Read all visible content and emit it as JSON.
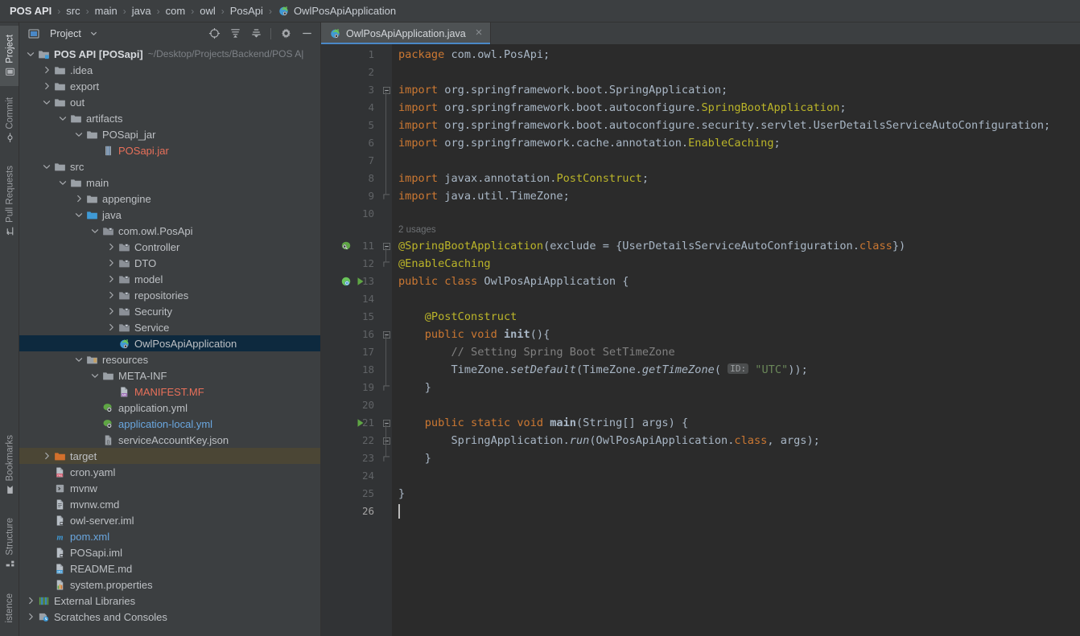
{
  "breadcrumb": {
    "items": [
      {
        "label": "POS API",
        "bold": true,
        "icon": null
      },
      {
        "label": "src",
        "bold": false,
        "icon": null
      },
      {
        "label": "main",
        "bold": false,
        "icon": null
      },
      {
        "label": "java",
        "bold": false,
        "icon": null
      },
      {
        "label": "com",
        "bold": false,
        "icon": null
      },
      {
        "label": "owl",
        "bold": false,
        "icon": null
      },
      {
        "label": "PosApi",
        "bold": false,
        "icon": null
      },
      {
        "label": "OwlPosApiApplication",
        "bold": false,
        "icon": "spring-boot-class-icon"
      }
    ],
    "separator": "›"
  },
  "tool_strip": {
    "top_items": [
      {
        "label": "Project",
        "icon": "project-icon",
        "active": true
      },
      {
        "label": "Commit",
        "icon": "commit-icon",
        "active": false
      },
      {
        "label": "Pull Requests",
        "icon": "pull-requests-icon",
        "active": false
      }
    ],
    "bottom_items": [
      {
        "label": "Bookmarks",
        "icon": "bookmarks-icon",
        "active": false
      },
      {
        "label": "Structure",
        "icon": "structure-icon",
        "active": false
      },
      {
        "label": "istence",
        "icon": null,
        "active": false
      }
    ]
  },
  "project_panel": {
    "title": "Project",
    "dropdown_icon": "chevron-down-icon",
    "tools": [
      {
        "name": "select-opened-file-icon",
        "title": "locate"
      },
      {
        "name": "expand-all-icon",
        "title": "expand all"
      },
      {
        "name": "collapse-all-icon",
        "title": "collapse all"
      },
      {
        "name": "settings-gear-icon",
        "title": "settings"
      },
      {
        "name": "minimize-icon",
        "title": "hide"
      }
    ],
    "tree": [
      {
        "label": "POS API [POSapi]",
        "suffix": "~/Desktop/Projects/Backend/POS A|",
        "depth": 0,
        "icon": "project-root-icon",
        "arrow": "down",
        "style": "bold",
        "state": "normal"
      },
      {
        "label": ".idea",
        "depth": 1,
        "icon": "folder-icon",
        "arrow": "right",
        "style": "normal",
        "state": "normal"
      },
      {
        "label": "export",
        "depth": 1,
        "icon": "folder-icon",
        "arrow": "right",
        "style": "normal",
        "state": "normal"
      },
      {
        "label": "out",
        "depth": 1,
        "icon": "folder-icon",
        "arrow": "down",
        "style": "normal",
        "state": "normal"
      },
      {
        "label": "artifacts",
        "depth": 2,
        "icon": "folder-icon",
        "arrow": "down",
        "style": "normal",
        "state": "normal"
      },
      {
        "label": "POSapi_jar",
        "depth": 3,
        "icon": "folder-icon",
        "arrow": "down",
        "style": "normal",
        "state": "normal"
      },
      {
        "label": "POSapi.jar",
        "depth": 4,
        "icon": "jar-icon",
        "arrow": "none",
        "style": "red",
        "state": "normal"
      },
      {
        "label": "src",
        "depth": 1,
        "icon": "folder-icon",
        "arrow": "down",
        "style": "normal",
        "state": "normal"
      },
      {
        "label": "main",
        "depth": 2,
        "icon": "folder-icon",
        "arrow": "down",
        "style": "normal",
        "state": "normal"
      },
      {
        "label": "appengine",
        "depth": 3,
        "icon": "folder-icon",
        "arrow": "right",
        "style": "normal",
        "state": "normal"
      },
      {
        "label": "java",
        "depth": 3,
        "icon": "source-folder-icon",
        "arrow": "down",
        "style": "normal",
        "state": "normal"
      },
      {
        "label": "com.owl.PosApi",
        "depth": 4,
        "icon": "package-icon",
        "arrow": "down",
        "style": "normal",
        "state": "normal"
      },
      {
        "label": "Controller",
        "depth": 5,
        "icon": "package-icon",
        "arrow": "right",
        "style": "normal",
        "state": "normal"
      },
      {
        "label": "DTO",
        "depth": 5,
        "icon": "package-icon",
        "arrow": "right",
        "style": "normal",
        "state": "normal"
      },
      {
        "label": "model",
        "depth": 5,
        "icon": "package-icon",
        "arrow": "right",
        "style": "normal",
        "state": "normal"
      },
      {
        "label": "repositories",
        "depth": 5,
        "icon": "package-icon",
        "arrow": "right",
        "style": "normal",
        "state": "normal"
      },
      {
        "label": "Security",
        "depth": 5,
        "icon": "package-icon",
        "arrow": "right",
        "style": "normal",
        "state": "normal"
      },
      {
        "label": "Service",
        "depth": 5,
        "icon": "package-icon",
        "arrow": "right",
        "style": "normal",
        "state": "normal"
      },
      {
        "label": "OwlPosApiApplication",
        "depth": 5,
        "icon": "spring-boot-class-icon",
        "arrow": "none",
        "style": "normal",
        "state": "selected"
      },
      {
        "label": "resources",
        "depth": 3,
        "icon": "resource-folder-icon",
        "arrow": "down",
        "style": "normal",
        "state": "normal"
      },
      {
        "label": "META-INF",
        "depth": 4,
        "icon": "folder-icon",
        "arrow": "down",
        "style": "normal",
        "state": "normal"
      },
      {
        "label": "MANIFEST.MF",
        "depth": 5,
        "icon": "manifest-file-icon",
        "arrow": "none",
        "style": "red",
        "state": "normal"
      },
      {
        "label": "application.yml",
        "depth": 4,
        "icon": "spring-yaml-icon",
        "arrow": "none",
        "style": "normal",
        "state": "normal"
      },
      {
        "label": "application-local.yml",
        "depth": 4,
        "icon": "spring-yaml-icon",
        "arrow": "none",
        "style": "blue",
        "state": "normal"
      },
      {
        "label": "serviceAccountKey.json",
        "depth": 4,
        "icon": "json-file-icon",
        "arrow": "none",
        "style": "normal",
        "state": "normal"
      },
      {
        "label": "target",
        "depth": 1,
        "icon": "excluded-folder-icon",
        "arrow": "right",
        "style": "normal",
        "state": "hovered"
      },
      {
        "label": "cron.yaml",
        "depth": 1,
        "icon": "yaml-file-icon",
        "arrow": "none",
        "style": "normal",
        "state": "normal"
      },
      {
        "label": "mvnw",
        "depth": 1,
        "icon": "script-file-icon",
        "arrow": "none",
        "style": "normal",
        "state": "normal"
      },
      {
        "label": "mvnw.cmd",
        "depth": 1,
        "icon": "text-file-icon",
        "arrow": "none",
        "style": "normal",
        "state": "normal"
      },
      {
        "label": "owl-server.iml",
        "depth": 1,
        "icon": "iml-file-icon",
        "arrow": "none",
        "style": "normal",
        "state": "normal"
      },
      {
        "label": "pom.xml",
        "depth": 1,
        "icon": "maven-icon",
        "arrow": "none",
        "style": "blue",
        "state": "normal"
      },
      {
        "label": "POSapi.iml",
        "depth": 1,
        "icon": "iml-file-icon",
        "arrow": "none",
        "style": "normal",
        "state": "normal"
      },
      {
        "label": "README.md",
        "depth": 1,
        "icon": "markdown-file-icon",
        "arrow": "none",
        "style": "normal",
        "state": "normal"
      },
      {
        "label": "system.properties",
        "depth": 1,
        "icon": "properties-file-icon",
        "arrow": "none",
        "style": "normal",
        "state": "normal"
      },
      {
        "label": "External Libraries",
        "depth": 0,
        "icon": "libraries-icon",
        "arrow": "right",
        "style": "normal",
        "state": "normal"
      },
      {
        "label": "Scratches and Consoles",
        "depth": 0,
        "icon": "scratches-icon",
        "arrow": "right",
        "style": "normal",
        "state": "normal"
      }
    ]
  },
  "editor": {
    "tabs": [
      {
        "label": "OwlPosApiApplication.java",
        "icon": "spring-boot-class-icon",
        "active": true,
        "close_icon": "close-icon"
      }
    ],
    "inlay_above_line_11": "2 usages",
    "current_line": 26,
    "gutter_icons": [
      {
        "line": 11,
        "icon": "spring-bean-icon"
      },
      {
        "line": 13,
        "icon": "spring-boot-icon"
      },
      {
        "line": 13,
        "icon": "run-gutter-icon"
      },
      {
        "line": 21,
        "icon": "run-gutter-icon"
      }
    ],
    "lines": [
      {
        "n": 1,
        "tokens": [
          {
            "t": "package",
            "c": "k"
          },
          {
            "t": " com.owl.PosApi;",
            "c": "pl"
          }
        ]
      },
      {
        "n": 2,
        "tokens": []
      },
      {
        "n": 3,
        "tokens": [
          {
            "t": "import",
            "c": "k"
          },
          {
            "t": " org.springframework.boot.SpringApplication;",
            "c": "pl"
          }
        ],
        "fold": "start"
      },
      {
        "n": 4,
        "tokens": [
          {
            "t": "import",
            "c": "k"
          },
          {
            "t": " org.springframework.boot.autoconfigure.",
            "c": "pl"
          },
          {
            "t": "SpringBootApplication",
            "c": "an"
          },
          {
            "t": ";",
            "c": "pl"
          }
        ]
      },
      {
        "n": 5,
        "tokens": [
          {
            "t": "import",
            "c": "k"
          },
          {
            "t": " org.springframework.boot.autoconfigure.security.servlet.UserDetailsServiceAutoConfiguration;",
            "c": "pl"
          }
        ]
      },
      {
        "n": 6,
        "tokens": [
          {
            "t": "import",
            "c": "k"
          },
          {
            "t": " org.springframework.cache.annotation.",
            "c": "pl"
          },
          {
            "t": "EnableCaching",
            "c": "an"
          },
          {
            "t": ";",
            "c": "pl"
          }
        ]
      },
      {
        "n": 7,
        "tokens": []
      },
      {
        "n": 8,
        "tokens": [
          {
            "t": "import",
            "c": "k"
          },
          {
            "t": " javax.annotation.",
            "c": "pl"
          },
          {
            "t": "PostConstruct",
            "c": "an"
          },
          {
            "t": ";",
            "c": "pl"
          }
        ]
      },
      {
        "n": 9,
        "tokens": [
          {
            "t": "import",
            "c": "k"
          },
          {
            "t": " java.util.TimeZone;",
            "c": "pl"
          }
        ],
        "fold": "end"
      },
      {
        "n": 10,
        "tokens": []
      },
      {
        "n": 11,
        "tokens": [
          {
            "t": "@SpringBootApplication",
            "c": "an"
          },
          {
            "t": "(exclude = {UserDetailsServiceAutoConfiguration.",
            "c": "pl"
          },
          {
            "t": "class",
            "c": "k"
          },
          {
            "t": "})",
            "c": "pl"
          }
        ],
        "fold": "start"
      },
      {
        "n": 12,
        "tokens": [
          {
            "t": "@EnableCaching",
            "c": "an"
          }
        ],
        "fold": "end"
      },
      {
        "n": 13,
        "tokens": [
          {
            "t": "public class ",
            "c": "k"
          },
          {
            "t": "OwlPosApiApplication",
            "c": "pl"
          },
          {
            "t": " {",
            "c": "pl"
          }
        ]
      },
      {
        "n": 14,
        "tokens": []
      },
      {
        "n": 15,
        "tokens": [
          {
            "t": "    @PostConstruct",
            "c": "an"
          }
        ]
      },
      {
        "n": 16,
        "tokens": [
          {
            "t": "    ",
            "c": "pl"
          },
          {
            "t": "public void ",
            "c": "k"
          },
          {
            "t": "init",
            "c": "wb"
          },
          {
            "t": "(){",
            "c": "pl"
          }
        ],
        "fold": "start"
      },
      {
        "n": 17,
        "tokens": [
          {
            "t": "        // Setting Spring Boot SetTimeZone",
            "c": "cm"
          }
        ]
      },
      {
        "n": 18,
        "tokens": [
          {
            "t": "        TimeZone.",
            "c": "pl"
          },
          {
            "t": "setDefault",
            "c": "it"
          },
          {
            "t": "(TimeZone.",
            "c": "pl"
          },
          {
            "t": "getTimeZone",
            "c": "it"
          },
          {
            "t": "( ",
            "c": "pl"
          },
          {
            "t": "ID:",
            "c": "hint"
          },
          {
            "t": " ",
            "c": "pl"
          },
          {
            "t": "\"UTC\"",
            "c": "st"
          },
          {
            "t": "));",
            "c": "pl"
          }
        ]
      },
      {
        "n": 19,
        "tokens": [
          {
            "t": "    }",
            "c": "pl"
          }
        ],
        "fold": "end"
      },
      {
        "n": 20,
        "tokens": []
      },
      {
        "n": 21,
        "tokens": [
          {
            "t": "    ",
            "c": "pl"
          },
          {
            "t": "public static void ",
            "c": "k"
          },
          {
            "t": "main",
            "c": "wb"
          },
          {
            "t": "(String[] args) {",
            "c": "pl"
          }
        ],
        "fold": "start"
      },
      {
        "n": 22,
        "tokens": [
          {
            "t": "        SpringApplication.",
            "c": "pl"
          },
          {
            "t": "run",
            "c": "it"
          },
          {
            "t": "(OwlPosApiApplication.",
            "c": "pl"
          },
          {
            "t": "class",
            "c": "k"
          },
          {
            "t": ", args);",
            "c": "pl"
          }
        ],
        "fold": "start"
      },
      {
        "n": 23,
        "tokens": [
          {
            "t": "    }",
            "c": "pl"
          }
        ],
        "fold": "end"
      },
      {
        "n": 24,
        "tokens": []
      },
      {
        "n": 25,
        "tokens": [
          {
            "t": "}",
            "c": "pl"
          }
        ]
      },
      {
        "n": 26,
        "tokens": []
      }
    ]
  },
  "colors": {
    "panel_bg": "#3c3f41",
    "editor_bg": "#2b2b2b",
    "gutter_bg": "#313335",
    "selection_bg": "#0d293e",
    "hover_bg": "#4b4635",
    "accent_blue": "#4a88c7",
    "keyword": "#cc7832",
    "annotation": "#bbb529",
    "string": "#6a8759",
    "comment": "#808080",
    "plain": "#a9b7c6"
  }
}
